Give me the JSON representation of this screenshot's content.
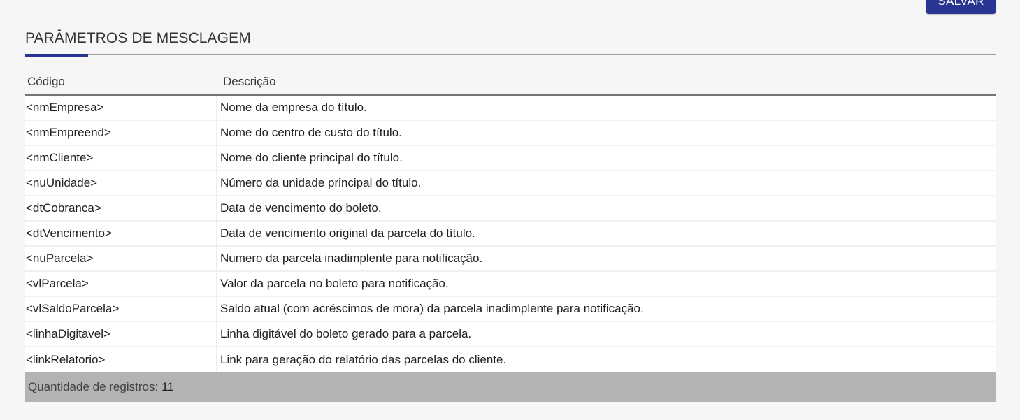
{
  "toolbar": {
    "save_label": "SALVAR"
  },
  "section": {
    "title": "PARÂMETROS DE MESCLAGEM"
  },
  "table": {
    "columns": [
      "Código",
      "Descrição"
    ],
    "rows": [
      {
        "code": "<nmEmpresa>",
        "description": "Nome da empresa do título."
      },
      {
        "code": "<nmEmpreend>",
        "description": "Nome do centro de custo do título."
      },
      {
        "code": "<nmCliente>",
        "description": "Nome do cliente principal do título."
      },
      {
        "code": "<nuUnidade>",
        "description": "Número da unidade principal do título."
      },
      {
        "code": "<dtCobranca>",
        "description": "Data de vencimento do boleto."
      },
      {
        "code": "<dtVencimento>",
        "description": "Data de vencimento original da parcela do título."
      },
      {
        "code": "<nuParcela>",
        "description": "Numero da parcela inadimplente para notificação."
      },
      {
        "code": "<vlParcela>",
        "description": "Valor da parcela no boleto para notificação."
      },
      {
        "code": "<vlSaldoParcela>",
        "description": "Saldo atual (com acréscimos de mora) da parcela inadimplente para notificação."
      },
      {
        "code": "<linhaDigitavel>",
        "description": "Linha digitável do boleto gerado para a parcela."
      },
      {
        "code": "<linkRelatorio>",
        "description": "Link para geração do relatório das parcelas do cliente."
      }
    ],
    "footer_label": "Quantidade de registros:",
    "footer_count": "11"
  },
  "colors": {
    "primary": "#283593",
    "footer_bg": "#b3b3b3",
    "page_bg": "#f6f6f6"
  }
}
